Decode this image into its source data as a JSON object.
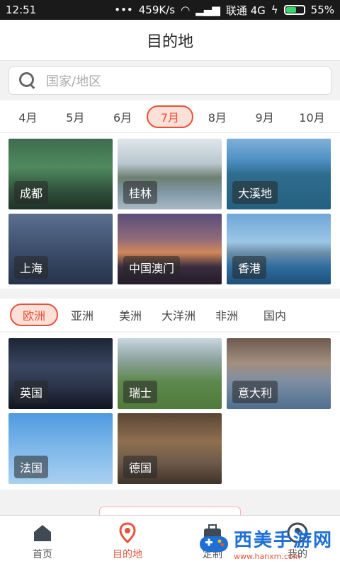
{
  "status": {
    "time": "12:51",
    "speed": "459K/s",
    "carrier": "联通 4G",
    "battery": "55%",
    "dots": "•••"
  },
  "header": {
    "title": "目的地"
  },
  "search": {
    "placeholder": "国家/地区"
  },
  "months": [
    "4月",
    "5月",
    "6月",
    "7月",
    "8月",
    "9月",
    "10月"
  ],
  "months_active": "7月",
  "destinations": [
    "成都",
    "桂林",
    "大溪地",
    "上海",
    "中国澳门",
    "香港"
  ],
  "regions": [
    "欧洲",
    "亚洲",
    "美洲",
    "大洋洲",
    "非洲",
    "国内"
  ],
  "regions_active": "欧洲",
  "countries": [
    "英国",
    "瑞士",
    "意大利",
    "法国",
    "德国"
  ],
  "tabs": {
    "home": "首页",
    "destination": "目的地",
    "custom": "定制",
    "mine": "我的"
  },
  "watermark": {
    "brand": "西美手游网",
    "url": "www.hanxm.com"
  },
  "colors": {
    "accent": "#e5533b",
    "brand_blue": "#1e6fd6"
  }
}
